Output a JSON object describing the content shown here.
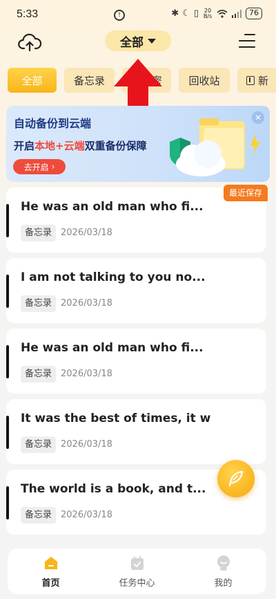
{
  "status_bar": {
    "time": "5:33",
    "net_speed_value": "20",
    "net_speed_unit": "B/s",
    "battery": "76"
  },
  "header": {
    "title": "全部"
  },
  "tabs": [
    {
      "label": "全部",
      "active": true
    },
    {
      "label": "备忘录",
      "active": false
    },
    {
      "label": "私密",
      "active": false
    },
    {
      "label": "回收站",
      "active": false
    },
    {
      "label": "新",
      "active": false
    }
  ],
  "banner": {
    "title": "自动备份到云端",
    "subtitle_prefix": "开启",
    "subtitle_highlight": "本地+云端",
    "subtitle_suffix": "双重备份保障",
    "button_label": "去开启"
  },
  "notes": [
    {
      "title": "He was an old man who fi...",
      "tag": "备忘录",
      "date": "2026/03/18",
      "badge": "最近保存"
    },
    {
      "title": "I am not talking to you no...",
      "tag": "备忘录",
      "date": "2026/03/18",
      "badge": ""
    },
    {
      "title": "He was an old man who fi...",
      "tag": "备忘录",
      "date": "2026/03/18",
      "badge": ""
    },
    {
      "title": "It was the best of times, it w",
      "tag": "备忘录",
      "date": "2026/03/18",
      "badge": ""
    },
    {
      "title": "The world is a book, and t...",
      "tag": "备忘录",
      "date": "2026/03/18",
      "badge": ""
    }
  ],
  "bottom_nav": [
    {
      "label": "首页",
      "icon": "home-icon",
      "active": true
    },
    {
      "label": "任务中心",
      "icon": "calendar-check-icon",
      "active": false
    },
    {
      "label": "我的",
      "icon": "profile-icon",
      "active": false
    }
  ],
  "colors": {
    "accent": "#f7b519",
    "highlight_red": "#ef4b3c",
    "badge_orange": "#f47a1f"
  }
}
